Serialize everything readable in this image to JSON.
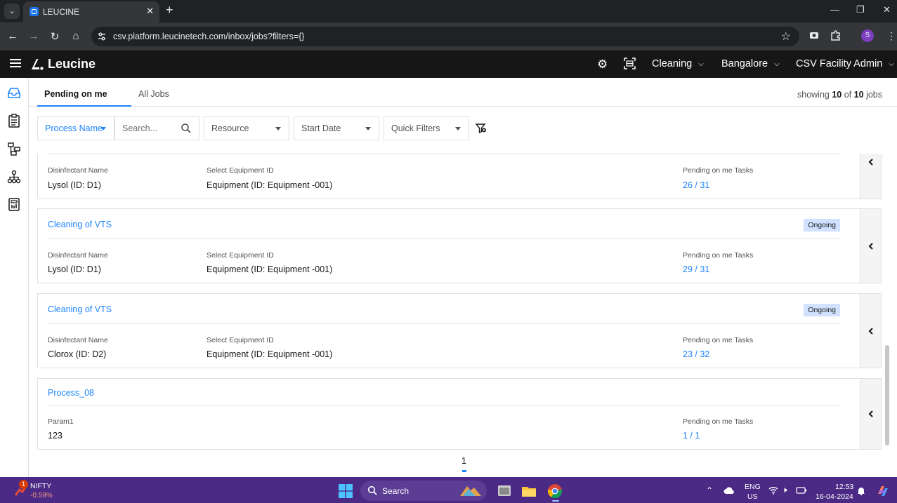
{
  "browser": {
    "tab_title": "LEUCINE",
    "url": "csv.platform.leucinetech.com/inbox/jobs?filters={}",
    "profile_initial": "S"
  },
  "header": {
    "brand": "Leucine",
    "use_case": "Cleaning",
    "facility": "Bangalore",
    "role": "CSV Facility Admin"
  },
  "tabs": {
    "pending": "Pending on me",
    "all": "All Jobs"
  },
  "showing": {
    "prefix": "showing",
    "count": "10",
    "of": "of",
    "total": "10",
    "suffix": "jobs"
  },
  "filters": {
    "process_name": "Process Name",
    "search_placeholder": "Search...",
    "resource": "Resource",
    "start_date": "Start Date",
    "quick_filters": "Quick Filters"
  },
  "jobs": [
    {
      "title": "",
      "status": "",
      "params": [
        {
          "label": "Disinfectant Name",
          "value": "Lysol (ID: D1)"
        },
        {
          "label": "Select Equipment ID",
          "value": "Equipment (ID: Equipment -001)"
        }
      ],
      "tasks_label": "Pending on me Tasks",
      "tasks_value": "26 / 31"
    },
    {
      "title": "Cleaning of VTS",
      "status": "Ongoing",
      "params": [
        {
          "label": "Disinfectant Name",
          "value": "Lysol (ID: D1)"
        },
        {
          "label": "Select Equipment ID",
          "value": "Equipment (ID: Equipment -001)"
        }
      ],
      "tasks_label": "Pending on me Tasks",
      "tasks_value": "29 / 31"
    },
    {
      "title": "Cleaning of VTS",
      "status": "Ongoing",
      "params": [
        {
          "label": "Disinfectant Name",
          "value": "Clorox (ID: D2)"
        },
        {
          "label": "Select Equipment ID",
          "value": "Equipment (ID: Equipment -001)"
        }
      ],
      "tasks_label": "Pending on me Tasks",
      "tasks_value": "23 / 32"
    },
    {
      "title": "Process_08",
      "status": "",
      "params": [
        {
          "label": "Param1",
          "value": "123"
        }
      ],
      "tasks_label": "Pending on me Tasks",
      "tasks_value": "1 / 1"
    }
  ],
  "pagination": {
    "current": "1"
  },
  "taskbar": {
    "ticker_badge": "1",
    "ticker_name": "NIFTY",
    "ticker_change": "-0.59%",
    "search": "Search",
    "lang_top": "ENG",
    "lang_bottom": "US",
    "time": "12:53",
    "date": "16-04-2024"
  },
  "colors": {
    "accent": "#1d84ff",
    "badge_bg": "#d0e2ff",
    "appbar": "#161616",
    "taskbar": "#4a2a84"
  }
}
